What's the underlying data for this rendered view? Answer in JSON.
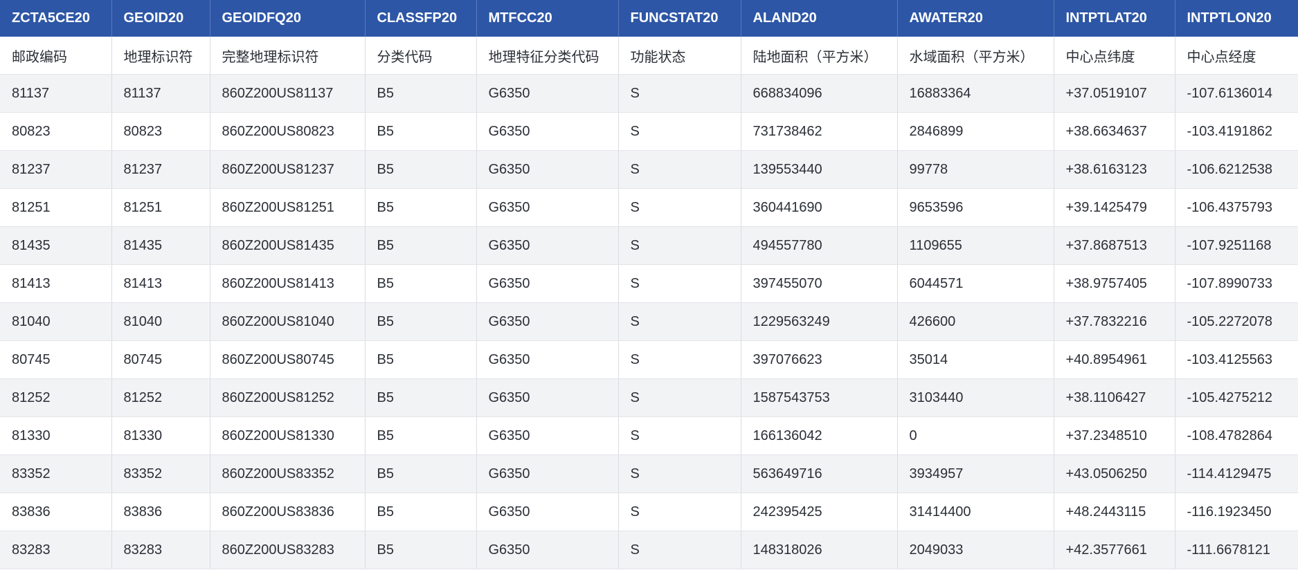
{
  "table": {
    "columns": [
      "ZCTA5CE20",
      "GEOID20",
      "GEOIDFQ20",
      "CLASSFP20",
      "MTFCC20",
      "FUNCSTAT20",
      "ALAND20",
      "AWATER20",
      "INTPTLAT20",
      "INTPTLON20"
    ],
    "descriptions": [
      "邮政编码",
      "地理标识符",
      "完整地理标识符",
      "分类代码",
      "地理特征分类代码",
      "功能状态",
      "陆地面积（平方米）",
      "水域面积（平方米）",
      "中心点纬度",
      "中心点经度"
    ],
    "rows": [
      [
        "81137",
        "81137",
        "860Z200US81137",
        "B5",
        "G6350",
        "S",
        "668834096",
        "16883364",
        "+37.0519107",
        "-107.6136014"
      ],
      [
        "80823",
        "80823",
        "860Z200US80823",
        "B5",
        "G6350",
        "S",
        "731738462",
        "2846899",
        "+38.6634637",
        "-103.4191862"
      ],
      [
        "81237",
        "81237",
        "860Z200US81237",
        "B5",
        "G6350",
        "S",
        "139553440",
        "99778",
        "+38.6163123",
        "-106.6212538"
      ],
      [
        "81251",
        "81251",
        "860Z200US81251",
        "B5",
        "G6350",
        "S",
        "360441690",
        "9653596",
        "+39.1425479",
        "-106.4375793"
      ],
      [
        "81435",
        "81435",
        "860Z200US81435",
        "B5",
        "G6350",
        "S",
        "494557780",
        "1109655",
        "+37.8687513",
        "-107.9251168"
      ],
      [
        "81413",
        "81413",
        "860Z200US81413",
        "B5",
        "G6350",
        "S",
        "397455070",
        "6044571",
        "+38.9757405",
        "-107.8990733"
      ],
      [
        "81040",
        "81040",
        "860Z200US81040",
        "B5",
        "G6350",
        "S",
        "1229563249",
        "426600",
        "+37.7832216",
        "-105.2272078"
      ],
      [
        "80745",
        "80745",
        "860Z200US80745",
        "B5",
        "G6350",
        "S",
        "397076623",
        "35014",
        "+40.8954961",
        "-103.4125563"
      ],
      [
        "81252",
        "81252",
        "860Z200US81252",
        "B5",
        "G6350",
        "S",
        "1587543753",
        "3103440",
        "+38.1106427",
        "-105.4275212"
      ],
      [
        "81330",
        "81330",
        "860Z200US81330",
        "B5",
        "G6350",
        "S",
        "166136042",
        "0",
        "+37.2348510",
        "-108.4782864"
      ],
      [
        "83352",
        "83352",
        "860Z200US83352",
        "B5",
        "G6350",
        "S",
        "563649716",
        "3934957",
        "+43.0506250",
        "-114.4129475"
      ],
      [
        "83836",
        "83836",
        "860Z200US83836",
        "B5",
        "G6350",
        "S",
        "242395425",
        "31414400",
        "+48.2443115",
        "-116.1923450"
      ],
      [
        "83283",
        "83283",
        "860Z200US83283",
        "B5",
        "G6350",
        "S",
        "148318026",
        "2049033",
        "+42.3577661",
        "-111.6678121"
      ]
    ]
  }
}
